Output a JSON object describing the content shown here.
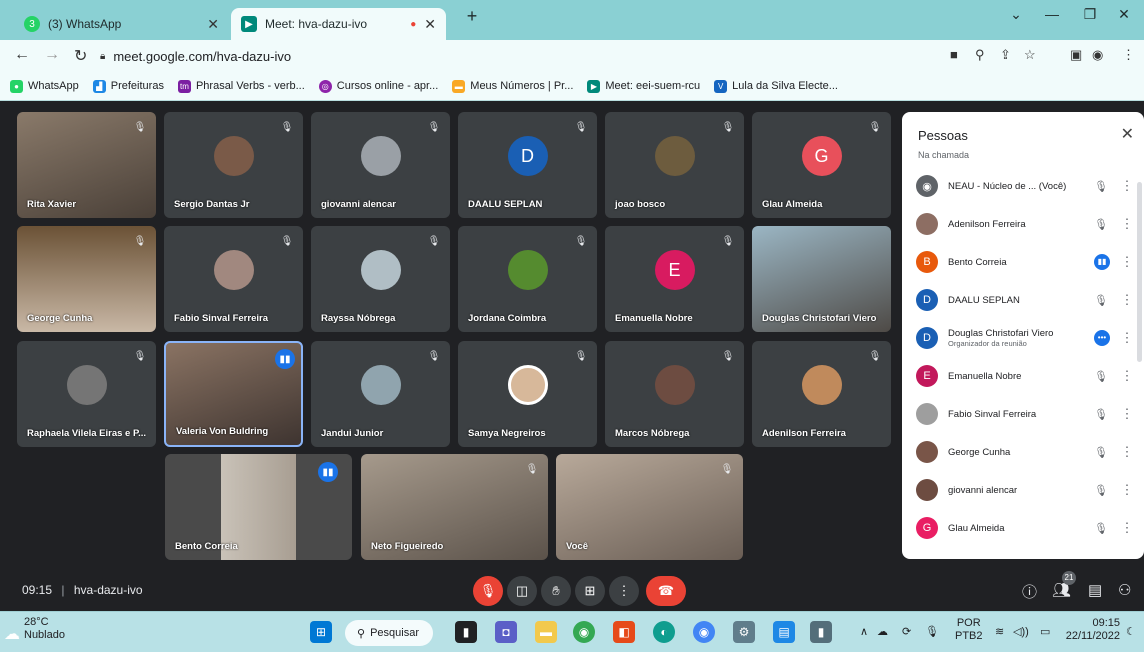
{
  "browser": {
    "tabs": [
      {
        "label": "(3) WhatsApp",
        "icon": "whatsapp-icon"
      },
      {
        "label": "Meet: hva-dazu-ivo",
        "icon": "google-meet-icon"
      }
    ],
    "url": "meet.google.com/hva-dazu-ivo",
    "bookmarks": [
      "WhatsApp",
      "Prefeituras",
      "Phrasal Verbs - verb...",
      "Cursos online - apr...",
      "Meus Números | Pr...",
      "Meet: eei-suem-rcu",
      "Lula da Silva Electe..."
    ]
  },
  "tiles": [
    {
      "name": "Rita Xavier"
    },
    {
      "name": "Sergio Dantas Jr"
    },
    {
      "name": "giovanni alencar"
    },
    {
      "name": "DAALU SEPLAN",
      "initial": "D"
    },
    {
      "name": "joao bosco"
    },
    {
      "name": "Glau Almeida",
      "initial": "G"
    },
    {
      "name": "George Cunha"
    },
    {
      "name": "Fabio Sinval Ferreira"
    },
    {
      "name": "Rayssa Nóbrega"
    },
    {
      "name": "Jordana Coimbra"
    },
    {
      "name": "Emanuella Nobre",
      "initial": "E"
    },
    {
      "name": "Douglas Christofari Viero"
    },
    {
      "name": "Raphaela Vilela Eiras e P..."
    },
    {
      "name": "Valeria Von Buldring"
    },
    {
      "name": "Jandui Junior"
    },
    {
      "name": "Samya Negreiros"
    },
    {
      "name": "Marcos Nóbrega"
    },
    {
      "name": "Adenilson Ferreira"
    },
    {
      "name": "Bento Correia"
    },
    {
      "name": "Neto Figueiredo"
    },
    {
      "name": "Você"
    }
  ],
  "bottom_bar": {
    "time": "09:15",
    "separator": "|",
    "meeting_code": "hva-dazu-ivo",
    "people_count": "21"
  },
  "panel": {
    "title": "Pessoas",
    "section": "Na chamada",
    "people": [
      {
        "name": "NEAU - Núcleo de ... (Você)",
        "initial": "",
        "color": "#5f6368"
      },
      {
        "name": "Adenilson Ferreira",
        "initial": "",
        "color": "#8d6e63"
      },
      {
        "name": "Bento Correia",
        "initial": "B",
        "color": "#e8590c"
      },
      {
        "name": "DAALU SEPLAN",
        "initial": "D",
        "color": "#1a5fb4"
      },
      {
        "name": "Douglas Christofari Viero",
        "sub": "Organizador da reunião",
        "initial": "D",
        "color": "#1a5fb4"
      },
      {
        "name": "Emanuella Nobre",
        "initial": "E",
        "color": "#c2185b"
      },
      {
        "name": "Fabio Sinval Ferreira",
        "initial": "",
        "color": "#9e9e9e"
      },
      {
        "name": "George Cunha",
        "initial": "",
        "color": "#795548"
      },
      {
        "name": "giovanni alencar",
        "initial": "",
        "color": "#6d4c41"
      },
      {
        "name": "Glau Almeida",
        "initial": "G",
        "color": "#e91e63"
      }
    ]
  },
  "taskbar": {
    "temp": "28°C",
    "condition": "Nublado",
    "search_label": "Pesquisar",
    "lang1": "POR",
    "lang2": "PTB2",
    "clock_time": "09:15",
    "clock_date": "22/11/2022"
  }
}
